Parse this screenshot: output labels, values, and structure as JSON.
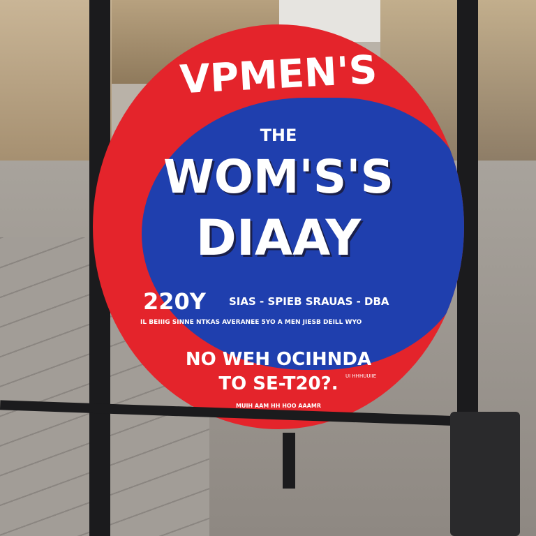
{
  "sign": {
    "top_arc": "VPMEN'S",
    "small_heading": "THE",
    "title_line1": "WOM'S'S",
    "title_line2": "DIAAY",
    "year": "220Y",
    "subtitle": "SIAS - SPIEB SRAUAS - DBA",
    "fine_print": "IL BEIIIG SINNE NTKAS AVERANEE 5YO A MEN JIESB DEILL WYO",
    "bottom_line1": "NO WEH OCIHNDA",
    "bottom_line2": "TO SE-T20?.",
    "bottom_small": "MUIH AAM HH HOO  AAAMR",
    "side_small": "UI HHHUUIIE"
  },
  "colors": {
    "red": "#e4242b",
    "blue": "#1f3fae"
  }
}
